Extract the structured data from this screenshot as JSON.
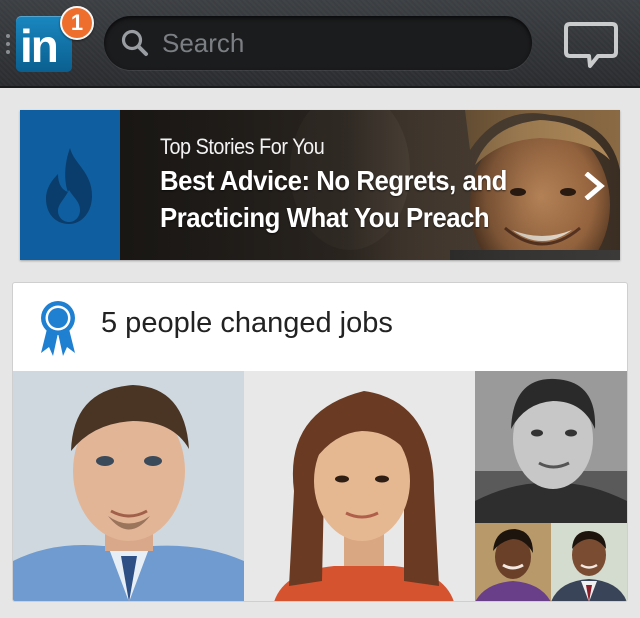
{
  "header": {
    "logo_text": "in",
    "notification_count": "1",
    "search_placeholder": "Search",
    "icons": {
      "grip": "grip-dots-icon",
      "search": "search-icon",
      "messages": "speech-bubble-icon"
    }
  },
  "top_story": {
    "kicker": "Top Stories For You",
    "headline": "Best Advice: No Regrets, and Practicing What You Preach",
    "source_icon": "flame-icon",
    "chevron_icon": "chevron-right-icon"
  },
  "update_card": {
    "icon": "award-ribbon-icon",
    "title": "5 people changed jobs",
    "photos": [
      "person-photo-1",
      "person-photo-2",
      "person-photo-3",
      "person-photo-4",
      "person-photo-5"
    ]
  },
  "colors": {
    "brand_blue": "#0e76a8",
    "badge_orange": "#ee6f2d",
    "source_blue": "#0f5fa0",
    "ribbon_blue": "#1f7fd1",
    "background": "#e6e6e6"
  }
}
